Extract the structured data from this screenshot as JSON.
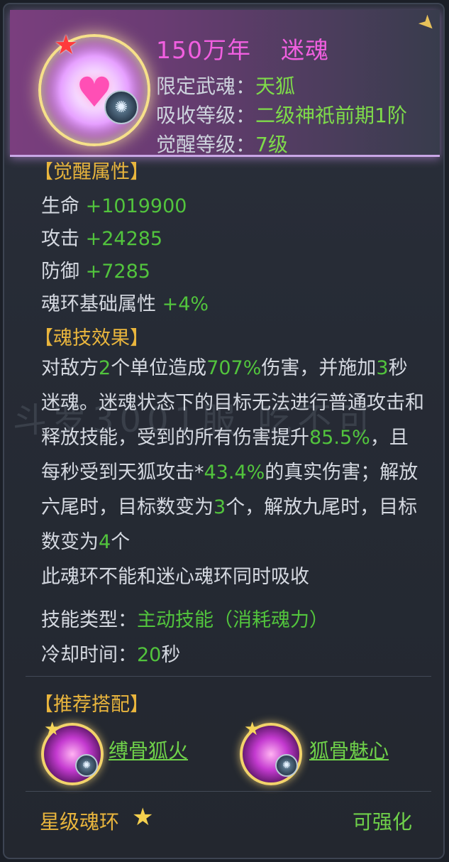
{
  "header": {
    "years": "150万年",
    "name": "迷魂",
    "rows": [
      {
        "label": "限定武魂：",
        "value": "天狐"
      },
      {
        "label": "吸收等级：",
        "value": "二级神祇前期1阶"
      },
      {
        "label": "觉醒等级：",
        "value": "7级"
      }
    ]
  },
  "awaken": {
    "title": "【觉醒属性】",
    "attrs": [
      {
        "label": "生命",
        "value": "+1019900"
      },
      {
        "label": "攻击",
        "value": "+24285"
      },
      {
        "label": "防御",
        "value": "+7285"
      },
      {
        "label": "魂环基础属性",
        "value": "+4%"
      }
    ]
  },
  "skill": {
    "title": "【魂技效果】",
    "desc": [
      {
        "t": "对敌方",
        "g": false
      },
      {
        "t": "2",
        "g": true
      },
      {
        "t": "个单位造成",
        "g": false
      },
      {
        "t": "707%",
        "g": true
      },
      {
        "t": "伤害，并施加",
        "g": false
      },
      {
        "t": "3",
        "g": true
      },
      {
        "t": "秒迷魂。迷魂状态下的目标无法进行普通攻击和释放技能，受到的所有伤害提升",
        "g": false
      },
      {
        "t": "85.5%",
        "g": true
      },
      {
        "t": "，且每秒受到天狐攻击*",
        "g": false
      },
      {
        "t": "43.4%",
        "g": true
      },
      {
        "t": "的真实伤害；解放六尾时，目标数变为",
        "g": false
      },
      {
        "t": "3",
        "g": true
      },
      {
        "t": "个，解放九尾时，目标数变为",
        "g": false
      },
      {
        "t": "4",
        "g": true
      },
      {
        "t": "个",
        "g": false
      }
    ],
    "note": "此魂环不能和迷心魂环同时吸收",
    "type_label": "技能类型：",
    "type_value": "主动技能（消耗魂力）",
    "cd_label": "冷却时间：",
    "cd_value": "20",
    "cd_unit": "秒"
  },
  "watermark": "斗罗3001服 吃不可",
  "recommend": {
    "title": "【推荐搭配】",
    "items": [
      {
        "name": "缚骨狐火"
      },
      {
        "name": "狐骨魅心"
      }
    ]
  },
  "footer": {
    "star_label": "星级魂环",
    "enhance": "可强化"
  },
  "colors": {
    "title_pink": "#f15fe0",
    "value_green": "#52c43d",
    "section_gold": "#e9b53d"
  },
  "icons": {
    "ring": "heart-soul-ring-icon",
    "badge": "fox-spirit-badge-icon",
    "rank_star": "red-star-icon",
    "rec_star": "gold-star-icon"
  }
}
